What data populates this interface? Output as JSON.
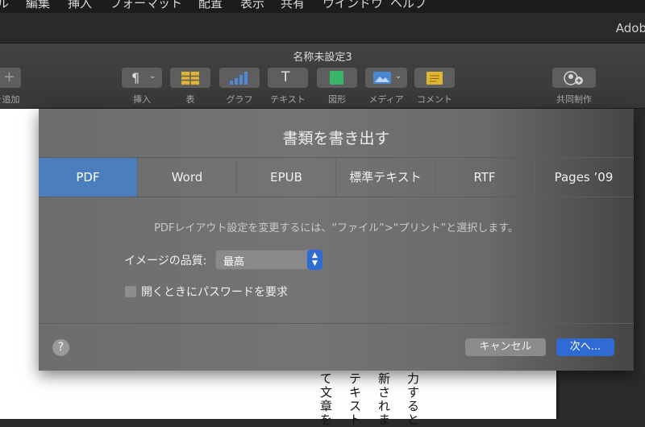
{
  "menubar": {
    "items": [
      "ル",
      "編集",
      "挿入",
      "フォーマット",
      "配置",
      "表示",
      "共有",
      "ウインドウ",
      "ヘルプ"
    ]
  },
  "window": {
    "tab_text": "Adob"
  },
  "toolbar": {
    "doc_title": "名称未設定3",
    "add_label": "を追加",
    "insert_label": "挿入",
    "table_label": "表",
    "chart_label": "グラフ",
    "text_label": "テキスト",
    "shape_label": "図形",
    "media_label": "メディア",
    "comment_label": "コメント",
    "collab_label": "共同制作",
    "icons": {
      "insert": "paragraph-icon",
      "table": "table-icon",
      "chart": "bar-chart-icon",
      "text": "text-cursor-icon",
      "shape": "shape-icon",
      "media": "image-icon",
      "comment": "comment-icon",
      "collab": "add-person-icon"
    }
  },
  "dialog": {
    "title": "書類を書き出す",
    "tabs": [
      "PDF",
      "Word",
      "EPUB",
      "標準テキスト",
      "RTF",
      "Pages ’09"
    ],
    "active_tab": "PDF",
    "info": "PDFレイアウト設定を変更するには、“ファイル”>“プリント”と選択します。",
    "quality_label": "イメージの品質:",
    "quality_value": "最高",
    "password_label": "開くときにパスワードを要求",
    "help_label": "?",
    "cancel_label": "キャンセル",
    "next_label": "次へ..."
  },
  "document": {
    "columns": [
      "て文章を",
      "テキスト",
      "新されま",
      "力すると"
    ]
  },
  "colors": {
    "accent": "#2f6bd3",
    "active_tab": "#4a7ebd"
  }
}
